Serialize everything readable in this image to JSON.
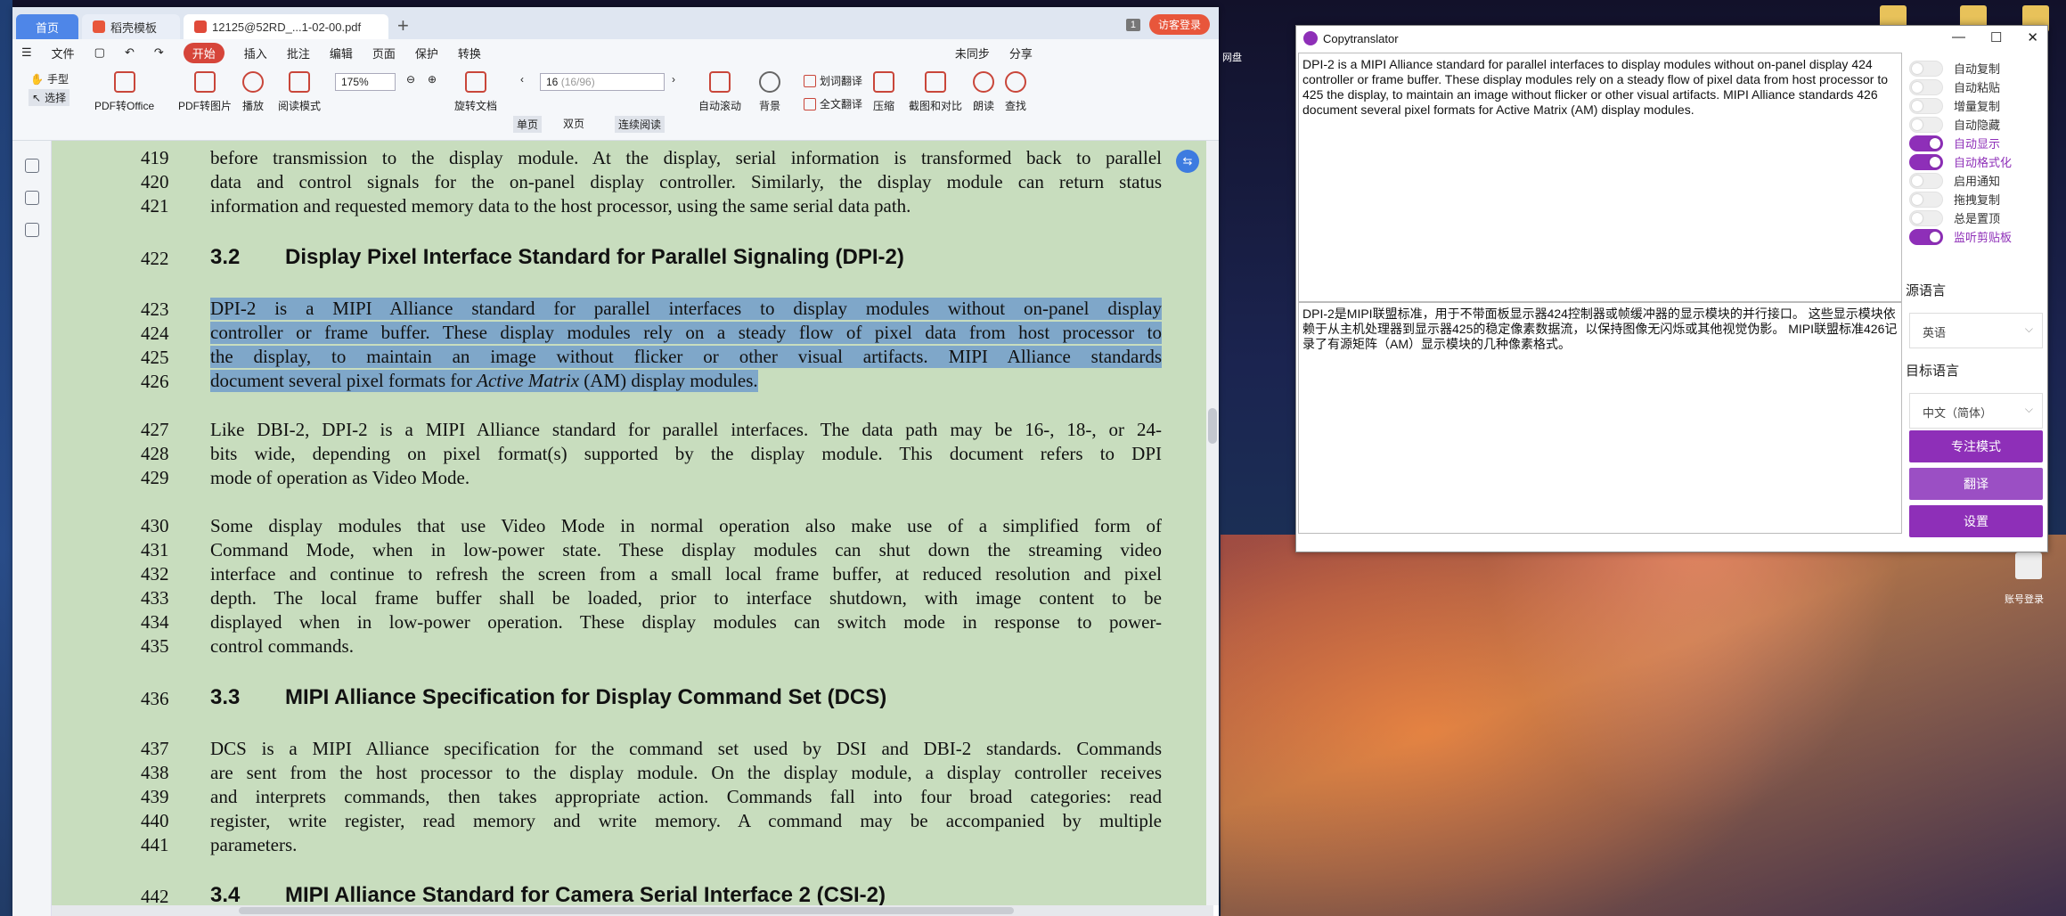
{
  "desktop": {
    "labels": [
      "网盘",
      "账号登录"
    ]
  },
  "wps": {
    "tabs": {
      "home": "首页",
      "template": "稻壳模板",
      "doc": "12125@52RD_...1-02-00.pdf"
    },
    "badge": "1",
    "login": "访客登录",
    "menu": {
      "file": "文件",
      "start": "开始",
      "insert": "插入",
      "annotate": "批注",
      "edit": "编辑",
      "page": "页面",
      "protect": "保护",
      "convert": "转换",
      "sync": "未同步",
      "share": "分享"
    },
    "ribbon": {
      "hand": "手型",
      "select": "选择",
      "pdf2office": "PDF转Office",
      "pdf2img": "PDF转图片",
      "play": "播放",
      "read": "阅读模式",
      "zoom": "175%",
      "rotate": "旋转文档",
      "single": "单页",
      "double": "双页",
      "continuous": "连续阅读",
      "page_value": "16",
      "page_total": "(16/96)",
      "autoscroll": "自动滚动",
      "bg": "背景",
      "wordtrans": "划词翻译",
      "fulltrans": "全文翻译",
      "compress": "压缩",
      "compare": "截图和对比",
      "readout": "朗读",
      "find": "查找"
    },
    "doc": {
      "lines": [
        {
          "n": "419",
          "t": "before transmission to the display module. At the display, serial information is transformed back to parallel"
        },
        {
          "n": "420",
          "t": "data and control signals for the on-panel display controller. Similarly, the display module can return status"
        },
        {
          "n": "421",
          "t": "information and requested memory data to the host processor, using the same serial data path."
        },
        {
          "n": "422",
          "num": "3.2",
          "h": "Display Pixel Interface Standard for Parallel Signaling (DPI-2)"
        },
        {
          "n": "423",
          "t": "DPI-2 is a MIPI Alliance standard for parallel interfaces to display modules without on-panel display"
        },
        {
          "n": "424",
          "t": "controller or frame buffer. These display modules rely on a steady flow of pixel data from host processor to"
        },
        {
          "n": "425",
          "t": "the display, to maintain an image without flicker or other visual artifacts. MIPI Alliance standards"
        },
        {
          "n": "426",
          "t1": "document several pixel formats for ",
          "ti": "Active Matrix",
          "t2": " (AM) display modules."
        },
        {
          "n": "427",
          "t": "Like DBI-2, DPI-2 is a MIPI Alliance standard for parallel interfaces. The data path may be 16-, 18-, or 24-"
        },
        {
          "n": "428",
          "t": "bits wide, depending on pixel format(s) supported by the display module. This document refers to DPI"
        },
        {
          "n": "429",
          "t": "mode of operation as Video Mode."
        },
        {
          "n": "430",
          "t": "Some display modules that use Video Mode in normal operation also make use of a simplified form of"
        },
        {
          "n": "431",
          "t": "Command Mode, when in low-power state. These display modules can shut down the streaming video"
        },
        {
          "n": "432",
          "t": "interface and continue to refresh the screen from a small local frame buffer, at reduced resolution and pixel"
        },
        {
          "n": "433",
          "t": "depth. The local frame buffer shall be loaded, prior to interface shutdown, with image content to be"
        },
        {
          "n": "434",
          "t": "displayed when in low-power operation. These display modules can switch mode in response to power-"
        },
        {
          "n": "435",
          "t": "control commands."
        },
        {
          "n": "436",
          "num": "3.3",
          "h": "MIPI Alliance Specification for Display Command Set (DCS)"
        },
        {
          "n": "437",
          "t": "DCS is a MIPI Alliance specification for the command set used by DSI and DBI-2 standards. Commands"
        },
        {
          "n": "438",
          "t": "are sent from the host processor to the display module. On the display module, a display controller receives"
        },
        {
          "n": "439",
          "t": "and interprets commands, then takes appropriate action. Commands fall into four broad categories: read"
        },
        {
          "n": "440",
          "t": "register, write register, read memory and write memory. A command may be accompanied by multiple"
        },
        {
          "n": "441",
          "t": "parameters."
        },
        {
          "n": "442",
          "num": "3.4",
          "h": "MIPI Alliance Standard for Camera Serial Interface 2 (CSI-2)"
        }
      ]
    }
  },
  "translator": {
    "title": "Copytranslator",
    "source_text": " DPI-2 is a MIPI Alliance standard for parallel interfaces to display modules without on-panel display  424 controller or frame buffer. These display modules rely on a steady flow of pixel data from host processor to  425 the display, to maintain an image without flicker or other visual artifacts. MIPI Alliance standards  426 document several pixel formats for Active Matrix (AM) display modules.",
    "result_text": "DPI-2是MIPI联盟标准，用于不带面板显示器424控制器或帧缓冲器的显示模块的并行接口。 这些显示模块依赖于从主机处理器到显示器425的稳定像素数据流，以保持图像无闪烁或其他视觉伪影。 MIPI联盟标准426记录了有源矩阵（AM）显示模块的几种像素格式。",
    "toggles": [
      {
        "label": "自动复制",
        "on": false
      },
      {
        "label": "自动粘贴",
        "on": false
      },
      {
        "label": "增量复制",
        "on": false
      },
      {
        "label": "自动隐藏",
        "on": false
      },
      {
        "label": "自动显示",
        "on": true
      },
      {
        "label": "自动格式化",
        "on": true
      },
      {
        "label": "启用通知",
        "on": false
      },
      {
        "label": "拖拽复制",
        "on": false
      },
      {
        "label": "总是置顶",
        "on": false
      },
      {
        "label": "监听剪贴板",
        "on": true
      }
    ],
    "source_lang_label": "源语言",
    "source_lang": "英语",
    "target_lang_label": "目标语言",
    "target_lang": "中文（简体）",
    "btn_focus": "专注模式",
    "btn_translate": "翻译",
    "btn_settings": "设置",
    "accent": "#8e2fb8"
  }
}
